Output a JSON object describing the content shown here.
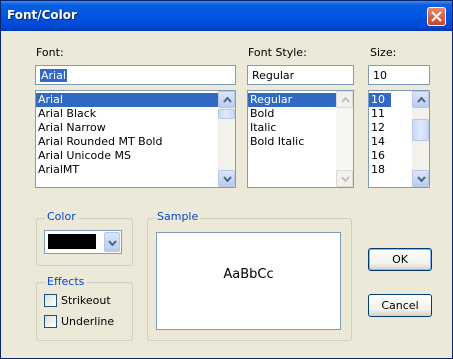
{
  "window": {
    "title": "Font/Color"
  },
  "font": {
    "label": "Font:",
    "value": "Arial",
    "items": [
      "Arial",
      "Arial Black",
      "Arial Narrow",
      "Arial Rounded MT Bold",
      "Arial Unicode MS",
      "ArialMT"
    ],
    "selected": "Arial"
  },
  "style": {
    "label": "Font Style:",
    "value": "Regular",
    "items": [
      "Regular",
      "Bold",
      "Italic",
      "Bold Italic"
    ],
    "selected": "Regular"
  },
  "size": {
    "label": "Size:",
    "value": "10",
    "items": [
      "10",
      "11",
      "12",
      "14",
      "16",
      "18"
    ],
    "selected": "10"
  },
  "color": {
    "label": "Color",
    "value": "#000000"
  },
  "effects": {
    "label": "Effects",
    "strikeout": {
      "label": "Strikeout",
      "checked": false
    },
    "underline": {
      "label": "Underline",
      "checked": false
    }
  },
  "sample": {
    "label": "Sample",
    "text": "AaBbCc"
  },
  "buttons": {
    "ok": "OK",
    "cancel": "Cancel"
  },
  "colors": {
    "titlebar": "#0055e5",
    "selection": "#316ac5",
    "group_label": "#0046d5",
    "close": "#c5442b"
  }
}
